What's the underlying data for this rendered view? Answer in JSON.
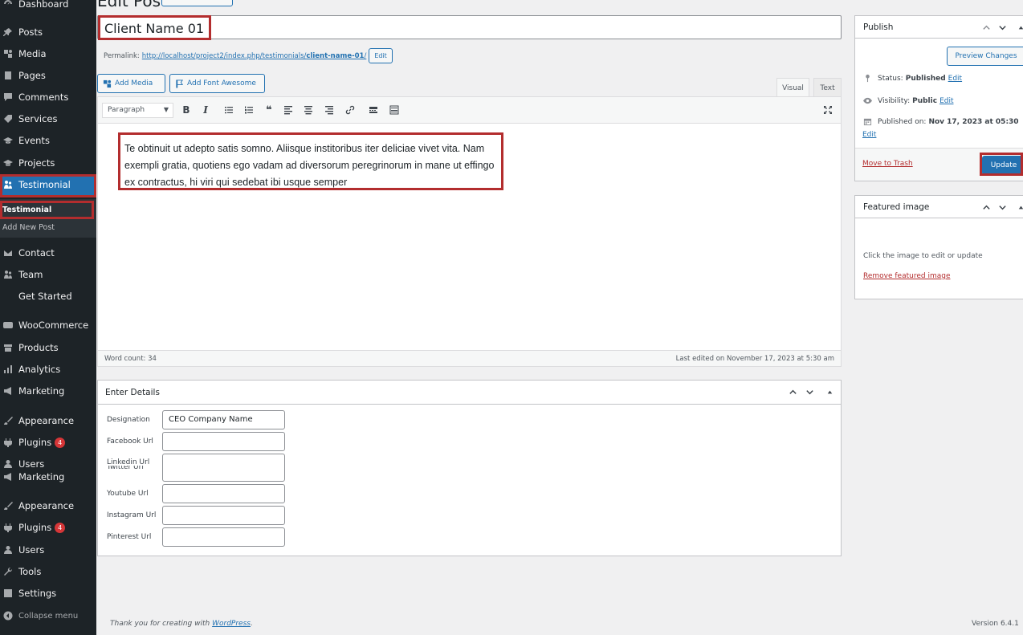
{
  "top": {
    "title": "Edit Post"
  },
  "sidebar": {
    "items": [
      {
        "label": "Dashboard"
      },
      {
        "label": "Posts"
      },
      {
        "label": "Media"
      },
      {
        "label": "Pages"
      },
      {
        "label": "Comments"
      },
      {
        "label": "Services"
      },
      {
        "label": "Events"
      },
      {
        "label": "Projects"
      },
      {
        "label": "Testimonial"
      },
      {
        "label": "Contact"
      },
      {
        "label": "Team"
      },
      {
        "label": "Get Started"
      },
      {
        "label": "WooCommerce"
      },
      {
        "label": "Products"
      },
      {
        "label": "Analytics"
      },
      {
        "label": "Marketing"
      },
      {
        "label": "Appearance"
      },
      {
        "label": "Plugins",
        "badge": "4"
      },
      {
        "label": "Users"
      },
      {
        "label": "Marketing"
      },
      {
        "label": "Appearance"
      },
      {
        "label": "Plugins",
        "badge": "4"
      },
      {
        "label": "Users"
      },
      {
        "label": "Tools"
      },
      {
        "label": "Settings"
      },
      {
        "label": "Collapse menu"
      }
    ],
    "submenu": {
      "current": "Testimonial",
      "add_new": "Add New Post"
    }
  },
  "post": {
    "title": "Client Name 01",
    "permalink_label": "Permalink:",
    "permalink_base": "http://localhost/project2/index.php/testimonials/",
    "permalink_slug": "client-name-01",
    "permalink_end": "/",
    "permalink_edit": "Edit"
  },
  "editor": {
    "add_media": "Add Media",
    "add_font_awesome": "Add Font Awesome",
    "tab_visual": "Visual",
    "tab_text": "Text",
    "format": "Paragraph",
    "content": "Te obtinuit ut adepto satis somno. Aliisque institoribus iter deliciae vivet vita. Nam exempli gratia, quotiens ego vadam ad diversorum peregrinorum in mane ut effingo ex contractus, hi viri qui sedebat ibi usque semper",
    "word_count": "Word count: 34",
    "last_edited": "Last edited on November 17, 2023 at 5:30 am"
  },
  "details": {
    "title": "Enter Details",
    "fields": [
      {
        "label": "Designation",
        "value": "CEO Company Name"
      },
      {
        "label": "Facebook Url",
        "value": ""
      },
      {
        "label": "Linkedin Url",
        "value": ""
      },
      {
        "label": "Twitter Url",
        "value": ""
      },
      {
        "label": "Youtube Url",
        "value": ""
      },
      {
        "label": "Instagram Url",
        "value": ""
      },
      {
        "label": "Pinterest Url",
        "value": ""
      }
    ]
  },
  "publish": {
    "title": "Publish",
    "preview": "Preview Changes",
    "status_label": "Status:",
    "status_value": "Published",
    "visibility_label": "Visibility:",
    "visibility_value": "Public",
    "published_label": "Published on:",
    "published_value": "Nov 17, 2023 at 05:30",
    "edit": "Edit",
    "trash": "Move to Trash",
    "update": "Update"
  },
  "featured": {
    "title": "Featured image",
    "hint": "Click the image to edit or update",
    "remove": "Remove featured image"
  },
  "footer": {
    "thanks": "Thank you for creating with",
    "wordpress": "WordPress",
    "period": ".",
    "version": "Version 6.4.1"
  },
  "colors": {
    "accent": "#2271b1",
    "sidebar": "#1d2327",
    "highlight": "#b32d2e",
    "danger": "#d63638"
  }
}
